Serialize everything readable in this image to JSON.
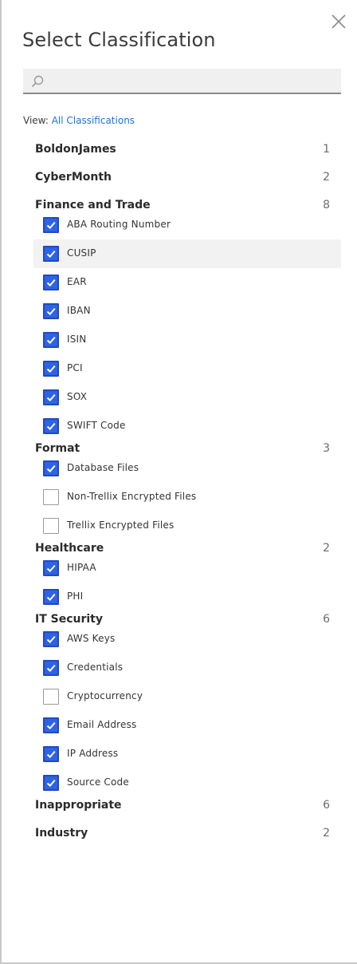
{
  "title": "Select Classification",
  "search": {
    "placeholder": "",
    "value": ""
  },
  "view": {
    "label": "View:",
    "value": "All Classifications"
  },
  "colors": {
    "accent": "#2f63e6",
    "link": "#1d72d8",
    "highlight_row": "#f2f2f2"
  },
  "icons": {
    "close": "close-icon",
    "search": "search-icon",
    "check": "check-icon"
  },
  "groups": [
    {
      "name": "BoldonJames",
      "count": "1",
      "items": []
    },
    {
      "name": "CyberMonth",
      "count": "2",
      "items": []
    },
    {
      "name": "Finance and Trade",
      "count": "8",
      "items": [
        {
          "label": "ABA Routing Number",
          "checked": true
        },
        {
          "label": "CUSIP",
          "checked": true,
          "highlighted": true
        },
        {
          "label": "EAR",
          "checked": true
        },
        {
          "label": "IBAN",
          "checked": true
        },
        {
          "label": "ISIN",
          "checked": true
        },
        {
          "label": "PCI",
          "checked": true
        },
        {
          "label": "SOX",
          "checked": true
        },
        {
          "label": "SWIFT Code",
          "checked": true
        }
      ]
    },
    {
      "name": "Format",
      "count": "3",
      "items": [
        {
          "label": "Database Files",
          "checked": true
        },
        {
          "label": "Non-Trellix Encrypted Files",
          "checked": false
        },
        {
          "label": "Trellix Encrypted Files",
          "checked": false
        }
      ]
    },
    {
      "name": "Healthcare",
      "count": "2",
      "items": [
        {
          "label": "HIPAA",
          "checked": true
        },
        {
          "label": "PHI",
          "checked": true
        }
      ]
    },
    {
      "name": "IT Security",
      "count": "6",
      "items": [
        {
          "label": "AWS Keys",
          "checked": true
        },
        {
          "label": "Credentials",
          "checked": true
        },
        {
          "label": "Cryptocurrency",
          "checked": false
        },
        {
          "label": "Email Address",
          "checked": true
        },
        {
          "label": "IP Address",
          "checked": true
        },
        {
          "label": "Source Code",
          "checked": true
        }
      ]
    },
    {
      "name": "Inappropriate",
      "count": "6",
      "items": []
    },
    {
      "name": "Industry",
      "count": "2",
      "items": []
    }
  ]
}
